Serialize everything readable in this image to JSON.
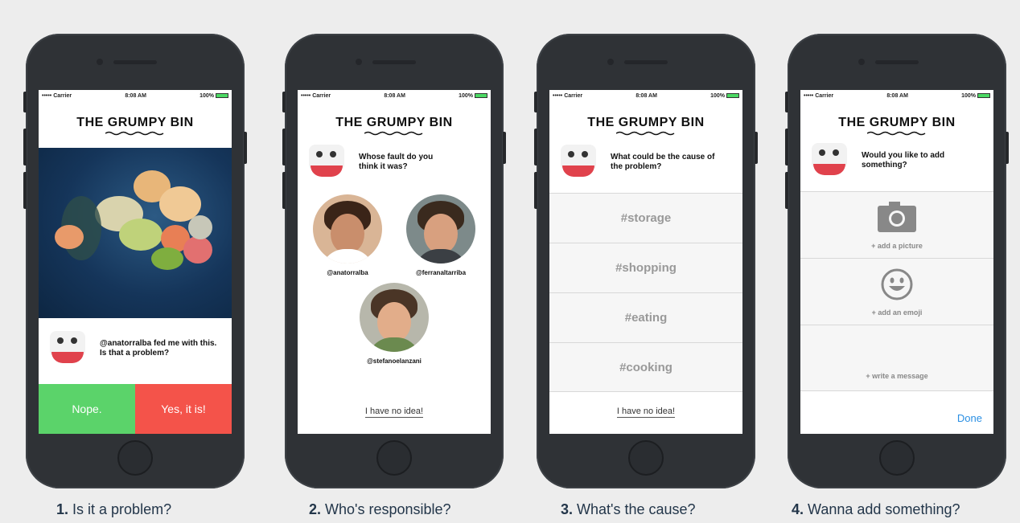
{
  "status": {
    "carrier": "••••• Carrier",
    "time": "8:08 AM",
    "battery": "100%"
  },
  "brand": {
    "title": "THE GRUMPY BIN"
  },
  "screen1": {
    "message": "@anatorralba fed me with this. Is that a problem?",
    "nope": "Nope.",
    "yes": "Yes, it is!"
  },
  "screen2": {
    "question": "Whose fault do you think it was?",
    "people": [
      {
        "handle": "@anatorralba"
      },
      {
        "handle": "@ferranaltarriba"
      },
      {
        "handle": "@stefanoelanzani"
      }
    ],
    "no_idea": "I have no idea!"
  },
  "screen3": {
    "question": "What could be the cause of the problem?",
    "tags": [
      "#storage",
      "#shopping",
      "#eating",
      "#cooking"
    ],
    "no_idea": "I have no idea!"
  },
  "screen4": {
    "question": "Would you like to add something?",
    "add_picture": "+ add a picture",
    "add_emoji": "+ add an emoji",
    "write_message": "+ write a message",
    "done": "Done"
  },
  "captions": [
    {
      "num": "1.",
      "text": "Is it a problem?"
    },
    {
      "num": "2.",
      "text": "Who's responsible?"
    },
    {
      "num": "3.",
      "text": "What's the cause?"
    },
    {
      "num": "4.",
      "text": "Wanna add something?"
    }
  ],
  "colors": {
    "green": "#5bd36a",
    "red": "#f4534a",
    "blue": "#2a8fe3",
    "caption": "#23364a"
  }
}
